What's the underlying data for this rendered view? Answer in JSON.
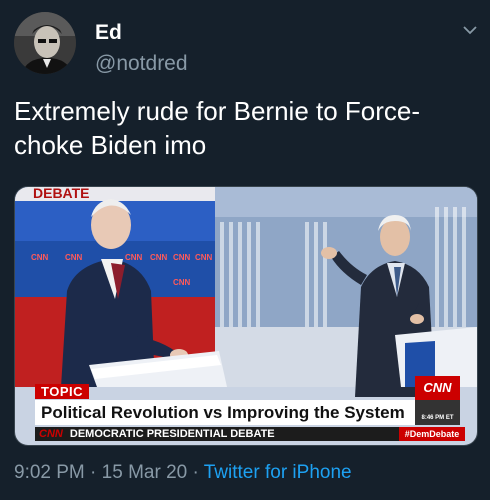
{
  "author": {
    "name": "Ed",
    "handle": "@notdred"
  },
  "tweet": {
    "text": "Extremely rude for Bernie to Force-choke Biden imo"
  },
  "media": {
    "topic_label": "TOPIC",
    "headline": "Political Revolution vs Improving the System",
    "network": "CNN",
    "time": "8:46 PM ET",
    "ticker_brand": "CNN",
    "ticker": "DEMOCRATIC PRESIDENTIAL DEBATE",
    "hashtag": "#DemDebate",
    "backdrop_text": "DEBATE",
    "podium_logos": [
      "CNN",
      "CNN",
      "CNN",
      "CNN",
      "CNN",
      "CNN",
      "CNN"
    ]
  },
  "meta": {
    "time": "9:02 PM",
    "separator": " · ",
    "date": "15 Mar 20",
    "source": "Twitter for iPhone"
  },
  "colors": {
    "background": "#15202b",
    "secondary_text": "#8899a6",
    "link": "#1da1f2",
    "cnn_red": "#cc0000"
  },
  "icons": {
    "chevron": "chevron-down-icon"
  }
}
